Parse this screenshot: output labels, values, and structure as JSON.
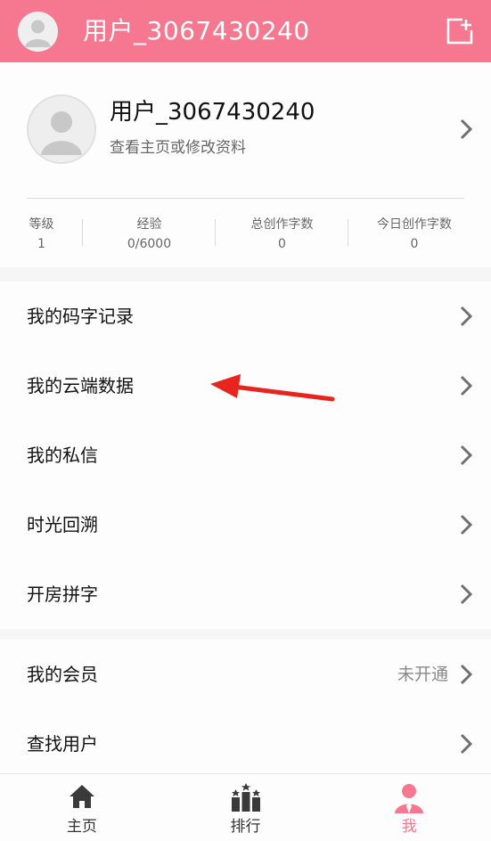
{
  "header": {
    "title": "用户_3067430240",
    "avatar_icon": "default-avatar-icon",
    "compose_icon": "compose-icon",
    "background_color": "#f57890"
  },
  "profile": {
    "name": "用户_3067430240",
    "subtitle": "查看主页或修改资料",
    "stats": [
      {
        "label": "等级",
        "value": "1"
      },
      {
        "label": "经验",
        "value": "0/6000"
      },
      {
        "label": "总创作字数",
        "value": "0"
      },
      {
        "label": "今日创作字数",
        "value": "0"
      }
    ]
  },
  "menu": {
    "group1": [
      {
        "label": "我的码字记录"
      },
      {
        "label": "我的云端数据"
      },
      {
        "label": "我的私信"
      },
      {
        "label": "时光回溯"
      },
      {
        "label": "开房拼字"
      }
    ],
    "group2": [
      {
        "label": "我的会员",
        "extra": "未开通"
      },
      {
        "label": "查找用户"
      }
    ]
  },
  "bottom_nav": {
    "tabs": [
      {
        "label": "主页",
        "icon": "home-icon"
      },
      {
        "label": "排行",
        "icon": "ranking-icon"
      },
      {
        "label": "我",
        "icon": "user-icon",
        "active": true
      }
    ],
    "active_color": "#f57890"
  },
  "annotation": {
    "arrow_color": "#e8241f"
  }
}
